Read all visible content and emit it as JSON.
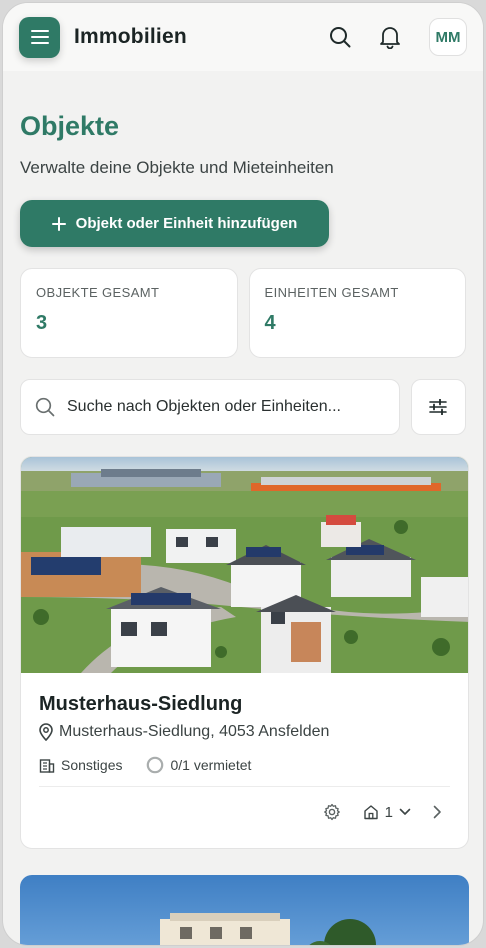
{
  "header": {
    "title": "Immobilien",
    "avatar_initials": "MM",
    "icons": [
      "menu-icon",
      "search-icon",
      "bell-icon"
    ]
  },
  "page": {
    "title": "Objekte",
    "subtitle": "Verwalte deine Objekte und Mieteinheiten",
    "add_button_label": "Objekt oder Einheit hinzufügen"
  },
  "stats": {
    "objects_label": "OBJEKTE GESAMT",
    "objects_value": "3",
    "units_label": "EINHEITEN GESAMT",
    "units_value": "4"
  },
  "search": {
    "placeholder": "Suche nach Objekten oder Einheiten..."
  },
  "objects": [
    {
      "name": "Musterhaus-Siedlung",
      "address": "Musterhaus-Siedlung, 4053 Ansfelden",
      "type": "Sonstiges",
      "occupancy": "0/1 vermietet",
      "units_count": "1"
    }
  ],
  "colors": {
    "accent": "#2f7a66",
    "background": "#f2f2f1",
    "card": "#ffffff"
  }
}
